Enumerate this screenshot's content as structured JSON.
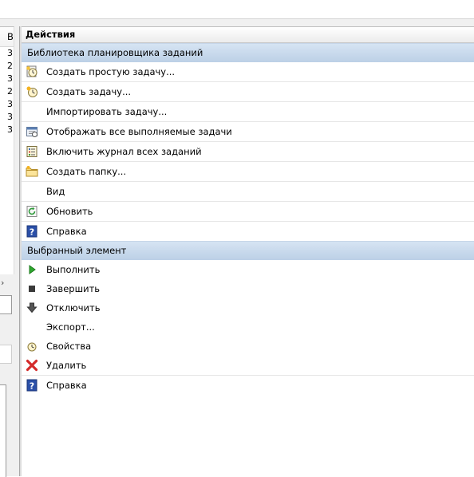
{
  "left_pane": {
    "header": "В",
    "rows": [
      "3",
      "2",
      "3",
      "2",
      "3",
      "3",
      "3"
    ],
    "scroll_arrow": "›"
  },
  "actions": {
    "title": "Действия",
    "groups": [
      {
        "title": "Библиотека планировщика заданий",
        "items": [
          {
            "label": "Создать простую задачу...",
            "icon": "create-basic-task-icon"
          },
          {
            "label": "Создать задачу...",
            "icon": "create-task-icon"
          },
          {
            "label": "Импортировать задачу...",
            "icon": ""
          },
          {
            "label": "Отображать все выполняемые задачи",
            "icon": "running-tasks-icon"
          },
          {
            "label": "Включить журнал всех заданий",
            "icon": "history-log-icon"
          },
          {
            "label": "Создать папку...",
            "icon": "folder-icon"
          },
          {
            "label": "Вид",
            "icon": ""
          },
          {
            "label": "Обновить",
            "icon": "refresh-icon"
          },
          {
            "label": "Справка",
            "icon": "help-icon"
          }
        ]
      },
      {
        "title": "Выбранный элемент",
        "items": [
          {
            "label": "Выполнить",
            "icon": "run-icon"
          },
          {
            "label": "Завершить",
            "icon": "stop-icon"
          },
          {
            "label": "Отключить",
            "icon": "disable-icon"
          },
          {
            "label": "Экспорт...",
            "icon": ""
          },
          {
            "label": "Свойства",
            "icon": "properties-icon"
          },
          {
            "label": "Удалить",
            "icon": "delete-icon"
          },
          {
            "label": "Справка",
            "icon": "help-icon"
          }
        ]
      }
    ]
  }
}
